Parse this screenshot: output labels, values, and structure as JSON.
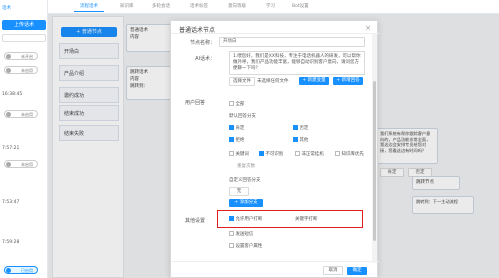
{
  "leftbar": {
    "top_button": "上传话术",
    "items": [
      {
        "label": "话术",
        "time": ""
      },
      {
        "label": "",
        "time": ""
      }
    ],
    "toggles": [
      "未开启",
      "未启用",
      "",
      "未启用",
      "",
      "未启用",
      "已启用"
    ],
    "timestamps": [
      "16:38:45",
      "7:57:21",
      "7:53:47",
      "7:59:28"
    ]
  },
  "tabs": [
    "流程话术",
    "知识库",
    "多轮会话",
    "话术标签",
    "意向等级",
    "学习",
    "Bot设置"
  ],
  "nodepanel": {
    "add_label": "+ 普通节点",
    "items": [
      "开场白",
      "产品介绍",
      "邀约成功",
      "结束成功",
      "结束失败"
    ]
  },
  "canvas": {
    "node1_title": "普通话术",
    "node1_sub": "内容",
    "node2_title": "跳转话术",
    "node2_sub": "内容",
    "node2_extra": "跳转到：",
    "right_text": "我们系统有帮你跟踪客户意向的，产品功能非常全面，我这边会安排专员给您对接，您看这边有时间吗？",
    "right_btn1": "肯定",
    "right_btn2": "否定",
    "jump_node": "跳转节点",
    "jump_node_sub": "跳转到：下一主动流程"
  },
  "modal": {
    "title": "普通话术节点",
    "close": "×",
    "name_label": "节点名称：",
    "name_value": "开场白",
    "ai_label": "AI话术：",
    "ai_text": "1.喂您好，我们是XX科技，专注于电话机器人的研发，可以帮你做外呼，我们产品功能丰富，能够自动识别客户意向，请问您方便聊一下吗？",
    "btn_select": "选择文件",
    "btn_upload": "未选择任何文件",
    "btn_new1": "+ 新建变量",
    "btn_new2": "+ 新增回答",
    "user_reply_label": "用户回答",
    "reply_all": "全部",
    "branch_title": "默认回答分支",
    "branches": [
      {
        "label": "肯定",
        "checked": true
      },
      {
        "label": "否定",
        "checked": true
      },
      {
        "label": "拒绝",
        "checked": true
      },
      {
        "label": "其他",
        "checked": true
      }
    ],
    "keyword_row": [
      "关键词",
      "不可识别",
      "非正常挂机",
      "知识库优先"
    ],
    "repeat_label": "重复次数",
    "custom_branch": "自定义回答分支",
    "no_item": "无",
    "add_branch_btn": "+ 添加分支",
    "other_label": "其他设置",
    "allow_interrupt": "允许用户打断",
    "keyword_interrupt": "关键字打断",
    "send_sms": "发送短信",
    "set_attr": "设置客户属性",
    "cancel": "取消",
    "ok": "确定"
  }
}
